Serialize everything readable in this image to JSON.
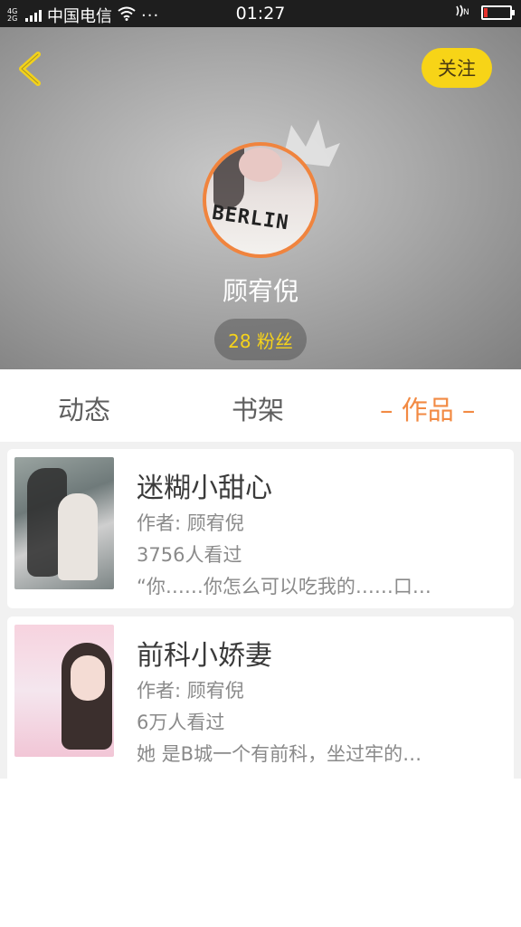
{
  "status_bar": {
    "network": "4G 2G",
    "carrier": "中国电信",
    "more": "···",
    "time": "01:27"
  },
  "header": {
    "follow_label": "关注",
    "username": "顾宥倪",
    "fans": "28 粉丝",
    "avatar_shirt_text": "BERLIN",
    "accent_color": "#f0843e",
    "follow_color": "#f7d417"
  },
  "tabs": [
    {
      "label": "动态"
    },
    {
      "label": "书架"
    },
    {
      "label": "– 作品 –",
      "active": true
    }
  ],
  "works": [
    {
      "title": "迷糊小甜心",
      "author": "作者: 顾宥倪",
      "views": "3756人看过",
      "desc": "“你……你怎么可以吃我的……口…"
    },
    {
      "title": "前科小娇妻",
      "author": "作者: 顾宥倪",
      "views": "6万人看过",
      "desc": "她 是B城一个有前科，坐过牢的…"
    }
  ]
}
